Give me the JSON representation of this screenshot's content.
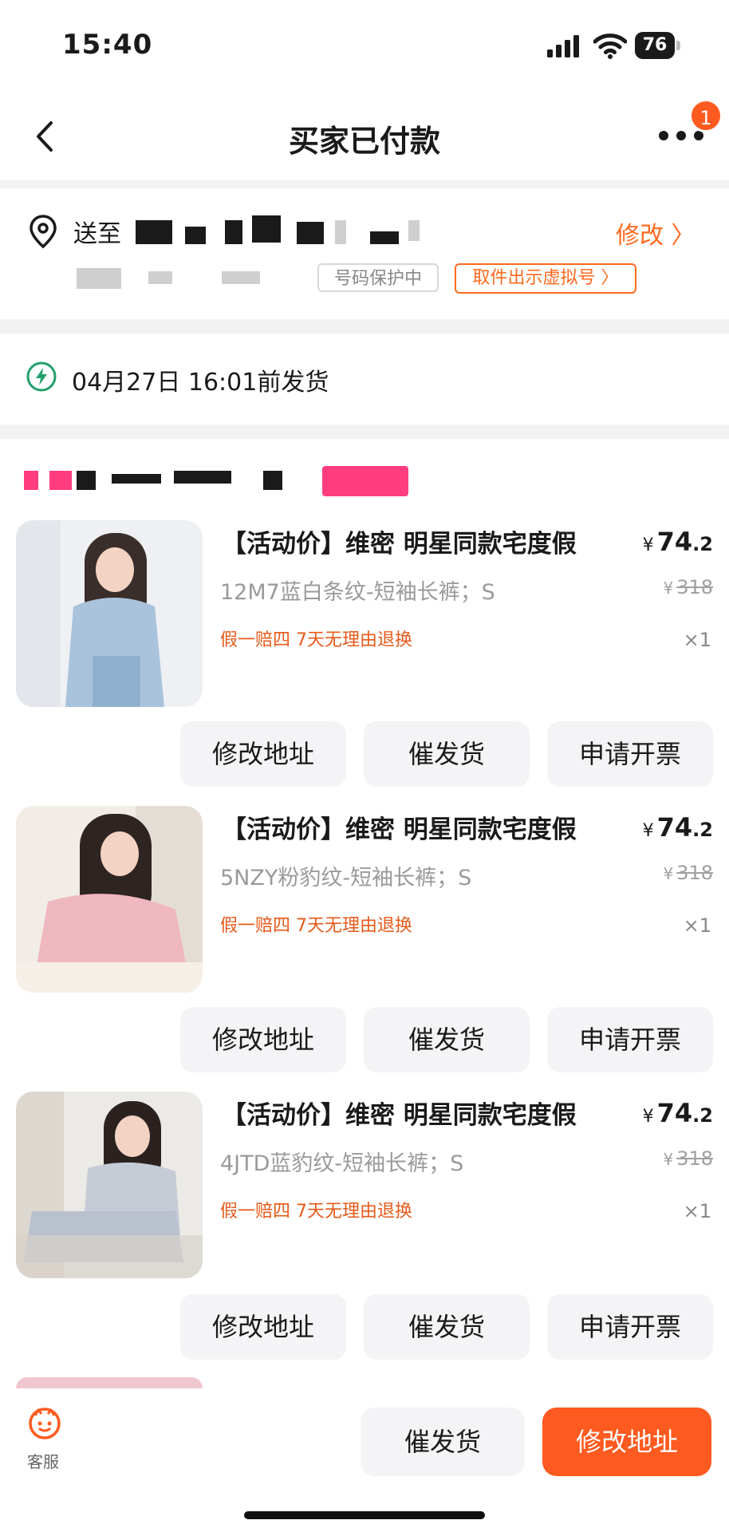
{
  "status_bar": {
    "time": "15:40",
    "battery": "76"
  },
  "nav": {
    "title": "买家已付款",
    "badge": "1"
  },
  "address": {
    "ship_label": "送至",
    "edit_label": "修改 〉",
    "protect_label": "号码保护中",
    "virtual_label": "取件出示虚拟号 〉"
  },
  "delivery": {
    "deadline": "04月27日 16:01前发货"
  },
  "products": [
    {
      "title": "【活动价】维密 明星同款宅度假",
      "price_int": "74",
      "price_dec": ".2",
      "spec": "12M7蓝白条纹-短袖长裤；S",
      "original": "318",
      "guarantee": "假一赔四  7天无理由退换",
      "qty": "×1"
    },
    {
      "title": "【活动价】维密 明星同款宅度假",
      "price_int": "74",
      "price_dec": ".2",
      "spec": "5NZY粉豹纹-短袖长裤；S",
      "original": "318",
      "guarantee": "假一赔四  7天无理由退换",
      "qty": "×1"
    },
    {
      "title": "【活动价】维密 明星同款宅度假",
      "price_int": "74",
      "price_dec": ".2",
      "spec": "4JTD蓝豹纹-短袖长裤；S",
      "original": "318",
      "guarantee": "假一赔四  7天无理由退换",
      "qty": "×1"
    }
  ],
  "item_actions": {
    "edit_address": "修改地址",
    "urge": "催发货",
    "invoice": "申请开票"
  },
  "currency": "¥",
  "bottom_bar": {
    "service_label": "客服",
    "urge": "催发货",
    "edit_address": "修改地址"
  },
  "colors": {
    "accent": "#ff5a1f",
    "guarantee": "#e65a1a",
    "button_bg": "#f4f4f6"
  }
}
